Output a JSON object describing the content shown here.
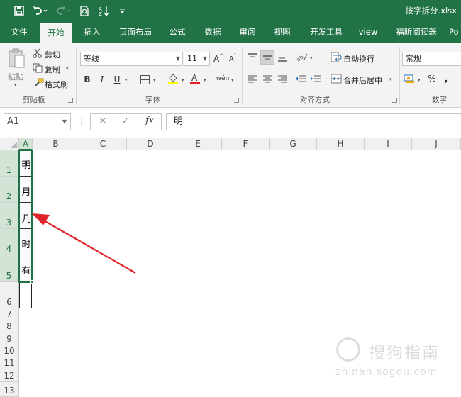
{
  "window": {
    "title": "按字拆分.xlsx"
  },
  "colors": {
    "brand": "#217346",
    "arrow": "#e0242b",
    "selection": "#217346"
  },
  "quick_access": [
    "save-icon",
    "undo-icon",
    "redo-icon",
    "print-preview-icon",
    "sort-icon",
    "customize-icon"
  ],
  "tabs": [
    "文件",
    "开始",
    "插入",
    "页面布局",
    "公式",
    "数据",
    "审阅",
    "视图",
    "开发工具",
    "view",
    "福昕阅读器",
    "Po"
  ],
  "active_tab": "开始",
  "clipboard": {
    "paste": "粘贴",
    "cut": "剪切",
    "copy": "复制",
    "format_painter": "格式刷",
    "group": "剪贴板"
  },
  "font": {
    "name": "等线",
    "size": "11",
    "bold": "B",
    "italic": "I",
    "underline": "U",
    "group": "字体"
  },
  "alignment": {
    "wrap": "自动换行",
    "merge": "合并后居中",
    "group": "对齐方式"
  },
  "number": {
    "format": "常规",
    "percent": "%",
    "comma": ",",
    "group": "数字"
  },
  "formula_bar": {
    "name_box": "A1",
    "fx": "fx",
    "value": "明"
  },
  "columns": [
    "A",
    "B",
    "C",
    "D",
    "E",
    "F",
    "G",
    "H",
    "I",
    "J"
  ],
  "selected_column": "A",
  "rows": [
    "1",
    "2",
    "3",
    "4",
    "5",
    "6",
    "7",
    "8",
    "9",
    "10",
    "11",
    "12",
    "13"
  ],
  "cells": [
    "明",
    "月",
    "几",
    "时",
    "有"
  ],
  "watermark": {
    "brand": "搜狗指南",
    "url": "zhinan.sogou.com"
  }
}
